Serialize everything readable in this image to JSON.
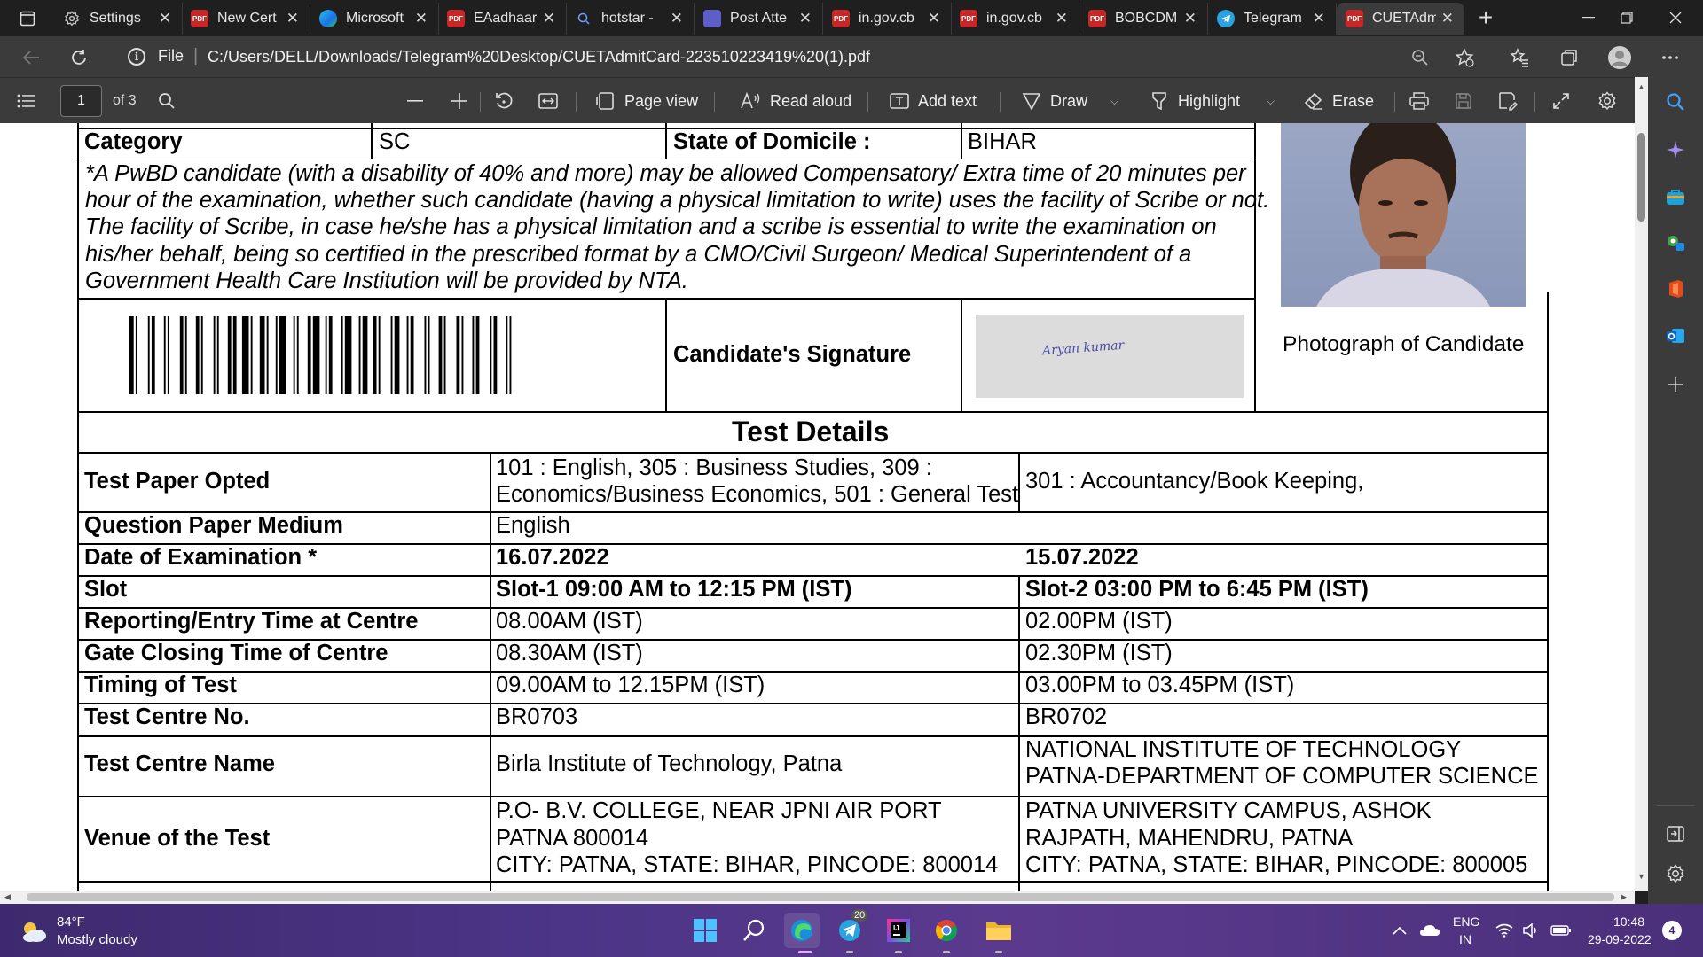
{
  "tabs": [
    {
      "title": "Settings",
      "icon": "gear-icon",
      "color": "#6b6b6b",
      "fav_text": ""
    },
    {
      "title": "New Cert",
      "icon": "pdf-icon",
      "color": "#c62828",
      "fav_text": "PDF"
    },
    {
      "title": "Microsoft",
      "icon": "edge-icon",
      "color": "#1e88e5",
      "fav_text": ""
    },
    {
      "title": "EAadhaar",
      "icon": "pdf-icon",
      "color": "#c62828",
      "fav_text": "PDF"
    },
    {
      "title": "hotstar -",
      "icon": "search-icon",
      "color": "#444",
      "fav_text": ""
    },
    {
      "title": "Post Atte",
      "icon": "teams-icon",
      "color": "#5b5fc7",
      "fav_text": ""
    },
    {
      "title": "in.gov.cb",
      "icon": "pdf-icon",
      "color": "#c62828",
      "fav_text": "PDF"
    },
    {
      "title": "in.gov.cb",
      "icon": "pdf-icon",
      "color": "#c62828",
      "fav_text": "PDF"
    },
    {
      "title": "BOBCDM",
      "icon": "pdf-icon",
      "color": "#c62828",
      "fav_text": "PDF"
    },
    {
      "title": "Telegram",
      "icon": "telegram-icon",
      "color": "#2aa3e0",
      "fav_text": ""
    },
    {
      "title": "CUETAdm",
      "icon": "pdf-icon",
      "color": "#c62828",
      "fav_text": "PDF",
      "active": true
    }
  ],
  "address": {
    "scheme_label": "File",
    "url": "C:/Users/DELL/Downloads/Telegram%20Desktop/CUETAdmitCard-223510223419%20(1).pdf"
  },
  "pdf_toolbar": {
    "page_number": "1",
    "page_count": "of 3",
    "page_view": "Page view",
    "read_aloud": "Read aloud",
    "add_text": "Add text",
    "draw": "Draw",
    "highlight": "Highlight",
    "erase": "Erase"
  },
  "document": {
    "category_label": "Category",
    "category_value": "SC",
    "domicile_label": "State of Domicile :",
    "domicile_value": "BIHAR",
    "pwbd_note": [
      "*A PwBD candidate (with a disability of 40% and more) may be allowed Compensatory/ Extra time of 20 minutes per",
      "hour of the examination, whether such candidate (having a physical limitation to write) uses the facility of Scribe or not.",
      "The facility of Scribe, in case he/she has a physical limitation and a scribe is essential to write the examination on",
      "his/her behalf, being so certified in the prescribed format by a CMO/Civil Surgeon/ Medical Superintendent of a",
      "Government Health Care Institution will be provided by NTA."
    ],
    "signature_label": "Candidate's Signature",
    "signature_text": "Aryan kumar",
    "photo_label": "Photograph of Candidate",
    "test_details_heading": "Test Details",
    "rows": {
      "paper_label": "Test Paper Opted",
      "paper_1": [
        "101 : English, 305 : Business Studies, 309 :",
        "Economics/Business Economics, 501 : General Test"
      ],
      "paper_2": "301 : Accountancy/Book Keeping,",
      "medium_label": "Question Paper Medium",
      "medium_value": "English",
      "date_label": "Date of Examination *",
      "date_1": "16.07.2022",
      "date_2": "15.07.2022",
      "slot_label": "Slot",
      "slot_1": "Slot-1 09:00 AM to 12:15 PM (IST)",
      "slot_2": "Slot-2 03:00 PM to 6:45 PM (IST)",
      "reporting_label": "Reporting/Entry Time at Centre",
      "reporting_1": "08.00AM (IST)",
      "reporting_2": "02.00PM (IST)",
      "gate_label": "Gate Closing Time of Centre",
      "gate_1": "08.30AM (IST)",
      "gate_2": "02.30PM (IST)",
      "timing_label": "Timing of Test",
      "timing_1": "09.00AM to 12.15PM (IST)",
      "timing_2": "03.00PM to 03.45PM (IST)",
      "centre_no_label": "Test Centre No.",
      "centre_no_1": "BR0703",
      "centre_no_2": "BR0702",
      "centre_name_label": "Test Centre Name",
      "centre_name_1": "Birla Institute of Technology, Patna",
      "centre_name_2": [
        "NATIONAL INSTITUTE OF TECHNOLOGY",
        "PATNA-DEPARTMENT OF COMPUTER SCIENCE"
      ],
      "venue_label": "Venue of the Test",
      "venue_1": [
        "P.O- B.V. COLLEGE, NEAR JPNI AIR PORT",
        "PATNA 800014",
        "CITY: PATNA, STATE: BIHAR, PINCODE: 800014"
      ],
      "venue_2": [
        "PATNA UNIVERSITY CAMPUS, ASHOK",
        "RAJPATH, MAHENDRU, PATNA",
        "CITY: PATNA, STATE: BIHAR, PINCODE: 800005"
      ]
    }
  },
  "taskbar": {
    "weather_temp": "84°F",
    "weather_desc": "Mostly cloudy",
    "telegram_badge": "20",
    "lang_1": "ENG",
    "lang_2": "IN",
    "time": "10:48",
    "date": "29-09-2022",
    "notification_count": "4"
  }
}
